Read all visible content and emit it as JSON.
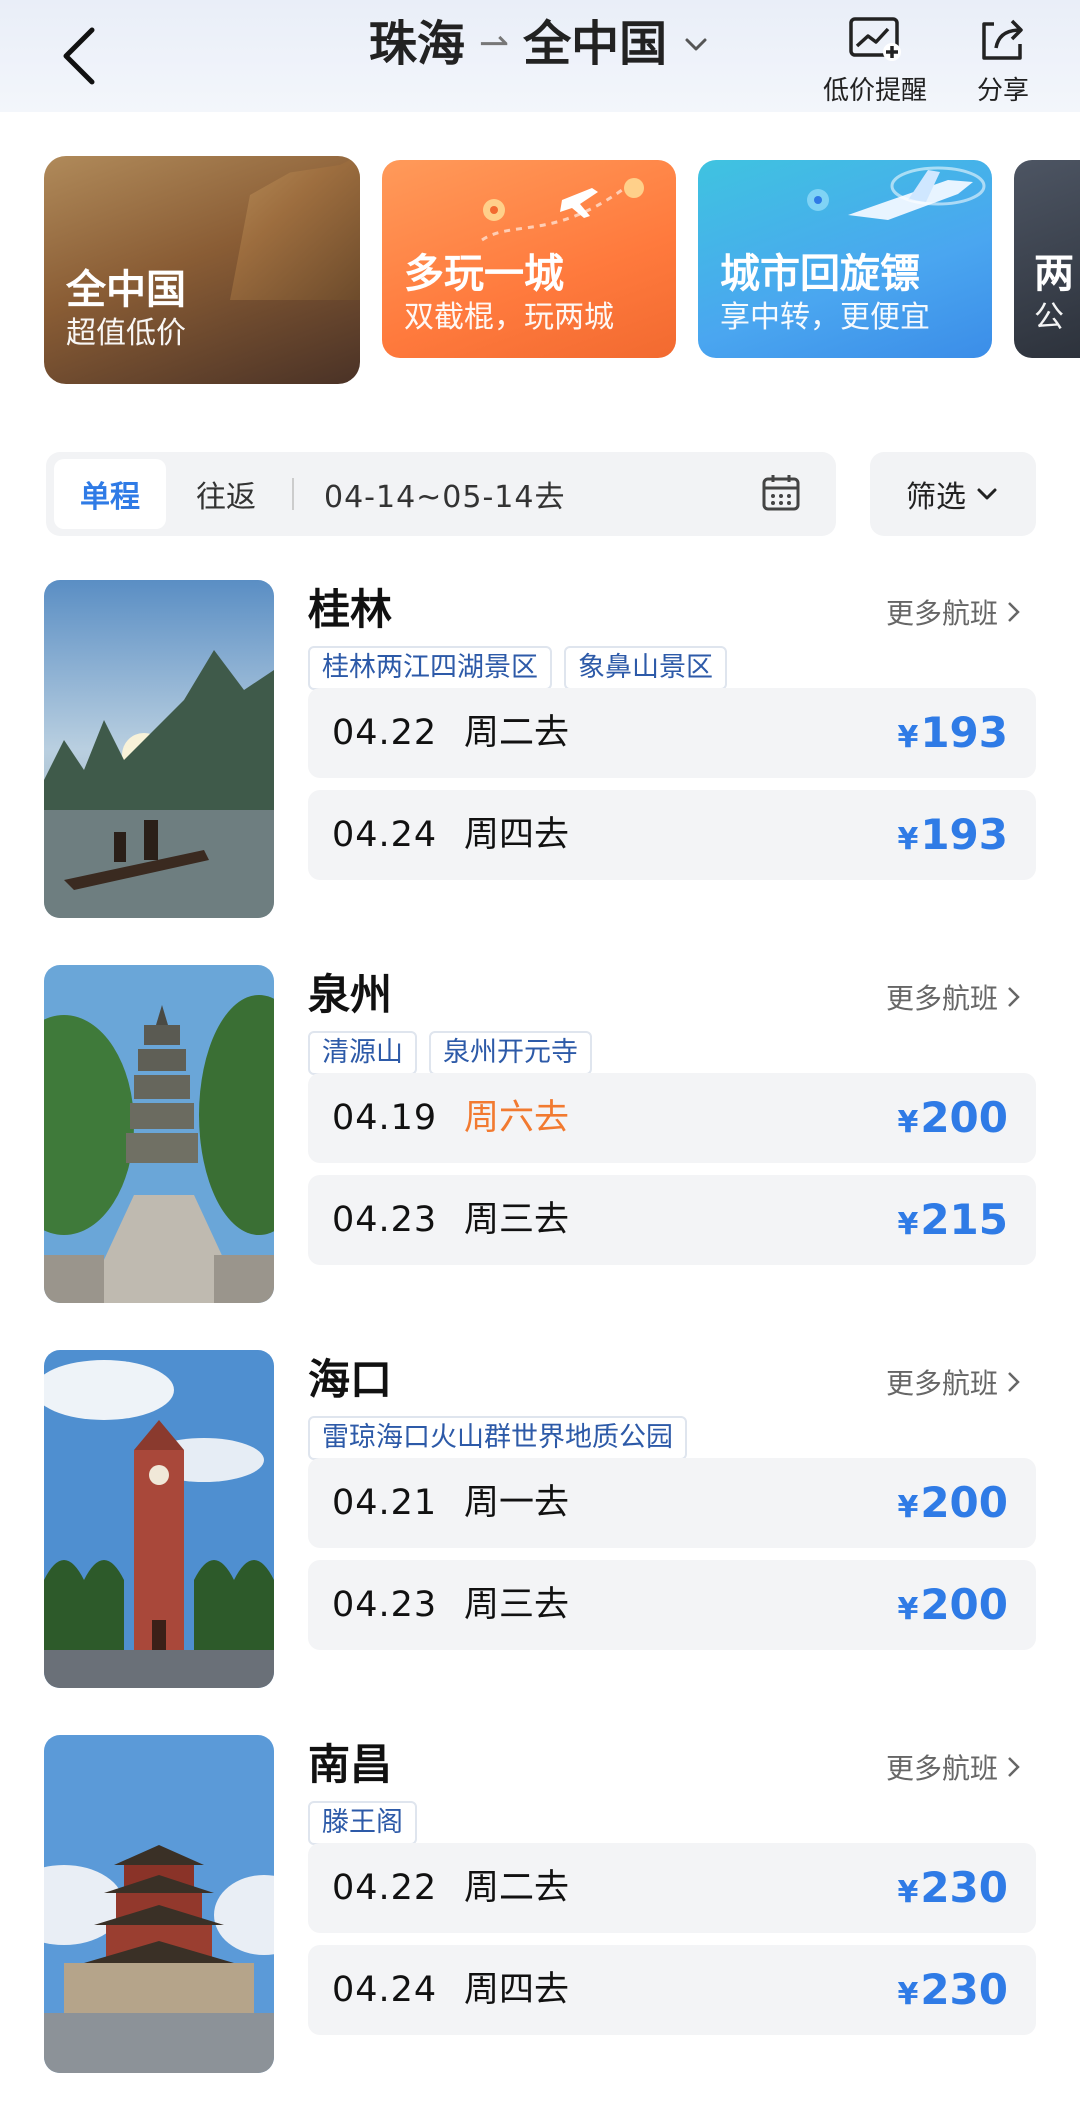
{
  "header": {
    "origin": "珠海",
    "arrow": "⇀",
    "destination": "全中国",
    "price_alert_label": "低价提醒",
    "share_label": "分享"
  },
  "promos": [
    {
      "title": "全中国",
      "subtitle": "超值低价"
    },
    {
      "title": "多玩一城",
      "subtitle": "双截棍，玩两城"
    },
    {
      "title": "城市回旋镖",
      "subtitle": "享中转，更便宜"
    },
    {
      "title": "两",
      "subtitle": "公"
    }
  ],
  "filter": {
    "one_way": "单程",
    "round_trip": "往返",
    "date_range": "04-14~05-14去",
    "filter_label": "筛选"
  },
  "destinations": [
    {
      "city": "桂林",
      "more": "更多航班",
      "tags": [
        "桂林两江四湖景区",
        "象鼻山景区"
      ],
      "flights": [
        {
          "date": "04.22",
          "weekday": "周二去",
          "currency": "¥",
          "price": "193"
        },
        {
          "date": "04.24",
          "weekday": "周四去",
          "currency": "¥",
          "price": "193"
        }
      ]
    },
    {
      "city": "泉州",
      "more": "更多航班",
      "tags": [
        "清源山",
        "泉州开元寺"
      ],
      "flights": [
        {
          "date": "04.19",
          "weekday": "周六去",
          "currency": "¥",
          "price": "200"
        },
        {
          "date": "04.23",
          "weekday": "周三去",
          "currency": "¥",
          "price": "215"
        }
      ]
    },
    {
      "city": "海口",
      "more": "更多航班",
      "tags": [
        "雷琼海口火山群世界地质公园"
      ],
      "flights": [
        {
          "date": "04.21",
          "weekday": "周一去",
          "currency": "¥",
          "price": "200"
        },
        {
          "date": "04.23",
          "weekday": "周三去",
          "currency": "¥",
          "price": "200"
        }
      ]
    },
    {
      "city": "南昌",
      "more": "更多航班",
      "tags": [
        "滕王阁"
      ],
      "flights": [
        {
          "date": "04.22",
          "weekday": "周二去",
          "currency": "¥",
          "price": "230"
        },
        {
          "date": "04.24",
          "weekday": "周四去",
          "currency": "¥",
          "price": "230"
        }
      ]
    }
  ],
  "colors": {
    "accent_blue": "#2f7be6",
    "weekend_orange": "#f27a30",
    "tag_text": "#2d5aa8"
  }
}
